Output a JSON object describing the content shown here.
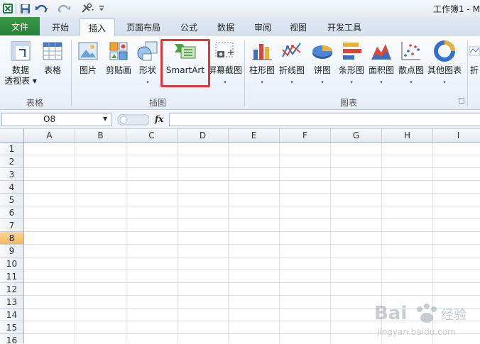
{
  "titlebar": {
    "doc_title": "工作簿1 - M",
    "save_icon": "save-icon",
    "undo_icon": "undo-icon",
    "redo_icon": "redo-icon",
    "customize_icon": "customize-icon"
  },
  "tabs": [
    {
      "label": "文件"
    },
    {
      "label": "开始"
    },
    {
      "label": "插入"
    },
    {
      "label": "页面布局"
    },
    {
      "label": "公式"
    },
    {
      "label": "数据"
    },
    {
      "label": "审阅"
    },
    {
      "label": "视图"
    },
    {
      "label": "开发工具"
    }
  ],
  "ribbon": {
    "pivot_line1": "数据",
    "pivot_line2": "透视表",
    "table": "表格",
    "picture": "图片",
    "clipart": "剪贴画",
    "shapes": "形状",
    "smartart": "SmartArt",
    "screenshot": "屏幕截图",
    "column_chart": "柱形图",
    "line_chart": "折线图",
    "pie_chart": "饼图",
    "bar_chart": "条形图",
    "area_chart": "面积图",
    "scatter_chart": "散点图",
    "other_charts": "其他图表",
    "sparkline_partial": "折",
    "group_tables": "表格",
    "group_illustrations": "插图",
    "group_charts": "图表"
  },
  "formula_bar": {
    "name_box": "O8",
    "fx_label": "fx",
    "formula": ""
  },
  "sheet": {
    "columns": [
      "A",
      "B",
      "C",
      "D",
      "E",
      "F",
      "G",
      "H",
      "I"
    ],
    "rows": [
      "1",
      "2",
      "3",
      "4",
      "5",
      "6",
      "7",
      "8",
      "9",
      "10",
      "11",
      "12",
      "13",
      "14",
      "15",
      "16"
    ],
    "selected_row": "8"
  },
  "watermark": {
    "brand": "Bai",
    "brand2": "经验",
    "url": "jingyan.baidu.com"
  }
}
